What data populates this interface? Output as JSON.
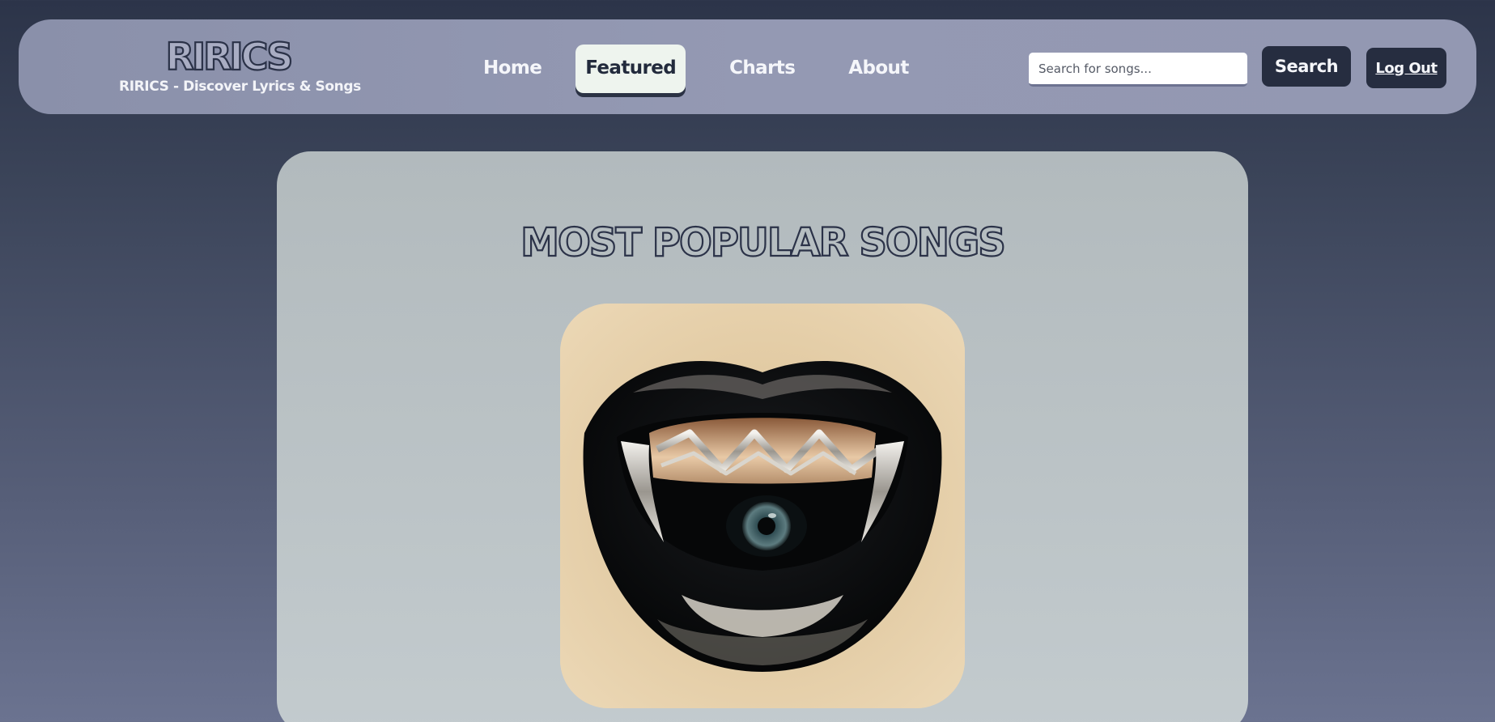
{
  "brand": {
    "logo": "RIRICS",
    "tagline": "RIRICS - Discover Lyrics & Songs"
  },
  "nav": {
    "items": [
      {
        "label": "Home",
        "active": false
      },
      {
        "label": "Featured",
        "active": true
      },
      {
        "label": "Charts",
        "active": false
      },
      {
        "label": "About",
        "active": false
      }
    ]
  },
  "search": {
    "placeholder": "Search for songs...",
    "value": "",
    "button_label": "Search"
  },
  "account": {
    "logout_label": "Log Out"
  },
  "main": {
    "title": "MOST POPULAR SONGS"
  },
  "colors": {
    "accent_dark": "#262d40",
    "header_bg": "#9196b0",
    "card_bg": "#b8c0c3",
    "active_tab_bg": "#eef4ee"
  }
}
